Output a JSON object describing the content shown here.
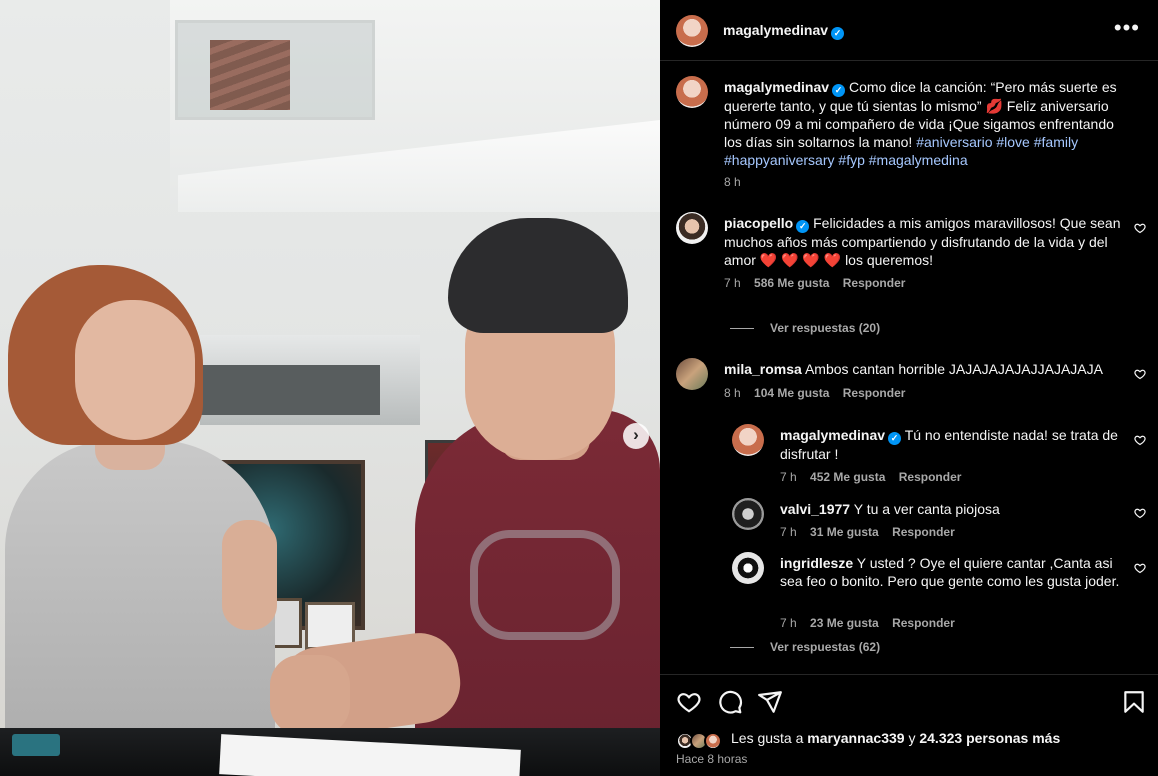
{
  "post": {
    "author": "magalymedinav",
    "more_icon": "more-horizontal-icon",
    "next_icon": "chevron-right-icon"
  },
  "caption": {
    "username": "magalymedinav",
    "text": "Como dice la canción: “Pero más suerte es quererte tanto, y que tú sientas lo mismo” 💋 Feliz aniversario número 09 a mi compañero de vida ¡Que sigamos enfrentando los días sin soltarnos la mano!",
    "hashtags": [
      "#aniversario",
      "#love",
      "#family",
      "#happyaniversary",
      "#fyp",
      "#magalymedina"
    ],
    "time": "8 h"
  },
  "comments": [
    {
      "username": "piacopello",
      "verified": true,
      "text": "Felicidades a mis amigos maravillosos! Que sean muchos años más compartiendo y disfrutando de la vida y del amor ❤️ ❤️ ❤️ ❤️  los queremos!",
      "time": "7 h",
      "likes": "586 Me gusta",
      "reply": "Responder",
      "view_replies": "Ver respuestas (20)"
    },
    {
      "username": "mila_romsa",
      "verified": false,
      "text": "Ambos cantan horrible JAJAJAJAJAJJAJAJAJA",
      "time": "8 h",
      "likes": "104 Me gusta",
      "reply": "Responder",
      "view_replies": "Ver respuestas (62)",
      "replies": [
        {
          "username": "magalymedinav",
          "verified": true,
          "text": "Tú no entendiste nada! se trata de disfrutar !",
          "time": "7 h",
          "likes": "452 Me gusta",
          "reply": "Responder"
        },
        {
          "username": "valvi_1977",
          "verified": false,
          "text": "Y tu a ver canta piojosa",
          "time": "7 h",
          "likes": "31 Me gusta",
          "reply": "Responder"
        },
        {
          "username": "ingridlesze",
          "verified": false,
          "text": "Y usted ? Oye el quiere cantar ,Canta asi sea feo o bonito. Pero que gente como les gusta joder.",
          "time": "7 h",
          "likes": "23 Me gusta",
          "reply": "Responder"
        }
      ]
    }
  ],
  "likes": {
    "prefix": "Les gusta a",
    "user": "maryannac339",
    "connector": "y",
    "others": "24.323 personas más"
  },
  "posted_ago": "Hace 8 horas",
  "icons": {
    "like": "heart-outline-icon",
    "comment": "comment-bubble-icon",
    "share": "paper-plane-icon",
    "save": "bookmark-icon"
  },
  "colors": {
    "background": "#000000",
    "text": "#f5f5f5",
    "muted": "#a8a8a8",
    "hashtag": "#a6c8ff",
    "verified": "#0095f6",
    "divider": "#262626"
  }
}
